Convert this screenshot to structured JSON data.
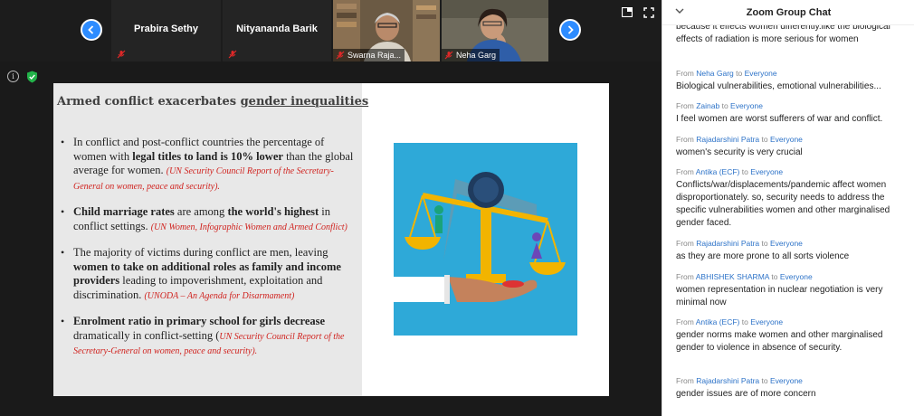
{
  "participants": {
    "tile1_name": "Prabira Sethy",
    "tile2_name": "Nityananda Barik",
    "video1_name": "Swarna Raja...",
    "video2_name": "Neha Garg"
  },
  "slide": {
    "title_plain": "Armed conflict exacerbates ",
    "title_underlined": "gender inequalities",
    "bullets": [
      {
        "a": "In conflict and post-conflict countries the percentage of women with ",
        "b": "legal titles to land is 10% lower",
        "c": " than the global average for women. ",
        "cite": "(UN Security Council Report of the Secretary-General on women, peace and security)."
      },
      {
        "b": "Child marriage rates",
        "a": " are among ",
        "b2": "the world's highest",
        "c": " in conflict settings. ",
        "cite": "(UN Women, Infographic Women and Armed Conflict)"
      },
      {
        "a": "The majority of victims during conflict are men, leaving ",
        "b": "women to take on additional roles as family and income providers",
        "c": " leading to impoverishment, exploitation and discrimination. ",
        "cite": "(UNODA – An Agenda for Disarmament)"
      },
      {
        "b": "Enrolment ratio in primary school for girls decrease",
        "c": " dramatically  in conflict-setting (",
        "cite": "UN Security Council Report of the Secretary-General on women, peace and security)."
      }
    ]
  },
  "chat": {
    "title": "Zoom Group Chat",
    "to_word": "to",
    "top_partial": "because it effects women differently.like the biological effects of radiation is more serious for women",
    "messages": [
      {
        "from": "Neha Garg",
        "to": "Everyone",
        "text": "Biological vulnerabilities, emotional vulnerabilities..."
      },
      {
        "from": "Zainab",
        "to": "Everyone",
        "text": "I feel women are worst sufferers of war and conflict."
      },
      {
        "from": "Rajadarshini Patra",
        "to": "Everyone",
        "text": "women's security is very crucial"
      },
      {
        "from": "Antika (ECF)",
        "to": "Everyone",
        "text": "Conflicts/war/displacements/pandemic  affect women disproportionately. so, security needs to address the specific vulnerabilities women and other marginalised gender faced."
      },
      {
        "from": "Rajadarshini Patra",
        "to": "Everyone",
        "text": "as they are more prone to all sorts violence"
      },
      {
        "from": "ABHISHEK SHARMA",
        "to": "Everyone",
        "text": "women representation in nuclear negotiation is very minimal now"
      },
      {
        "from": "Antika (ECF)",
        "to": "Everyone",
        "text": "gender norms make women and other marginalised gender to violence in absence of security."
      },
      {
        "from": "Rajadarshini Patra",
        "to": "Everyone",
        "text": "gender issues are of more concern"
      }
    ]
  },
  "colors": {
    "accent_blue": "#2d8cff",
    "sender_blue": "#2d73c8",
    "citation_red": "#d0231f",
    "mute_red": "#e02828"
  }
}
